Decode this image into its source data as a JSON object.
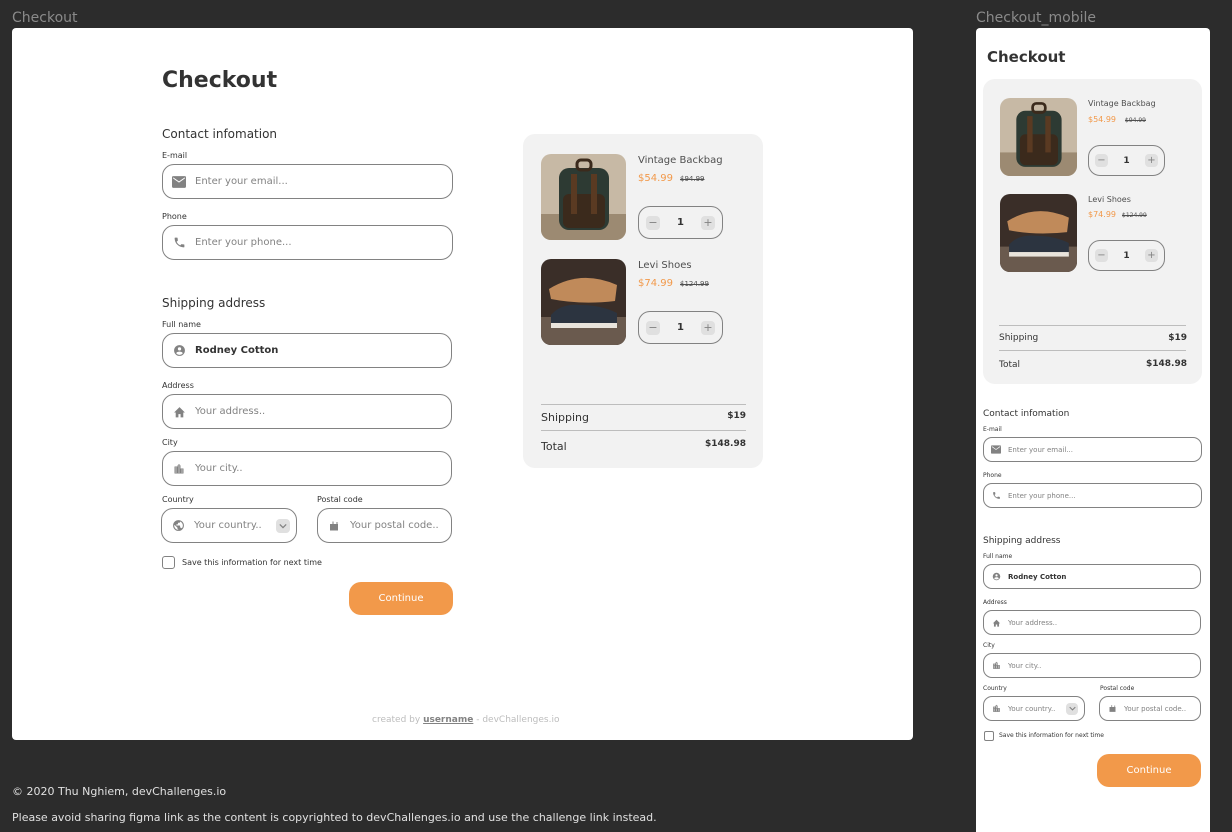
{
  "canvas": {
    "desktop_frame_label": "Checkout",
    "mobile_frame_label": "Checkout_mobile",
    "copyright": "© 2020 Thu Nghiem, devChallenges.io",
    "notice": "Please avoid sharing figma link as the content is copyrighted to devChallenges.io and use the challenge link instead."
  },
  "checkout": {
    "title": "Checkout",
    "contact": {
      "heading": "Contact infomation",
      "email_label": "E-mail",
      "email_placeholder": "Enter your email...",
      "phone_label": "Phone",
      "phone_placeholder": "Enter your phone..."
    },
    "shipping": {
      "heading": "Shipping address",
      "fullname_label": "Full name",
      "fullname_value": "Rodney Cotton",
      "address_label": "Address",
      "address_placeholder": "Your address..",
      "city_label": "City",
      "city_placeholder": "Your city..",
      "country_label": "Country",
      "country_placeholder": "Your country..",
      "postal_label": "Postal code",
      "postal_placeholder": "Your postal code..",
      "save_label": "Save this information for next time"
    },
    "continue_label": "Continue",
    "cart": {
      "items": [
        {
          "name": "Vintage Backbag",
          "price": "$54.99",
          "old_price": "$94.99",
          "qty": "1"
        },
        {
          "name": "Levi Shoes",
          "price": "$74.99",
          "old_price": "$124.99",
          "qty": "1"
        }
      ],
      "shipping_label": "Shipping",
      "shipping_value": "$19",
      "total_label": "Total",
      "total_value": "$148.98"
    },
    "credit": {
      "prefix": "created by",
      "user": "username",
      "suffix": "- devChallenges.io"
    }
  },
  "colors": {
    "accent": "#f2994a",
    "canvas": "#2c2c2c",
    "cart_bg": "#f2f2f2",
    "border": "#828282"
  },
  "icons": [
    "mail-icon",
    "phone-icon",
    "account-icon",
    "home-icon",
    "city-icon",
    "globe-icon",
    "location-icon",
    "chevron-down-icon",
    "minus-icon",
    "plus-icon"
  ]
}
